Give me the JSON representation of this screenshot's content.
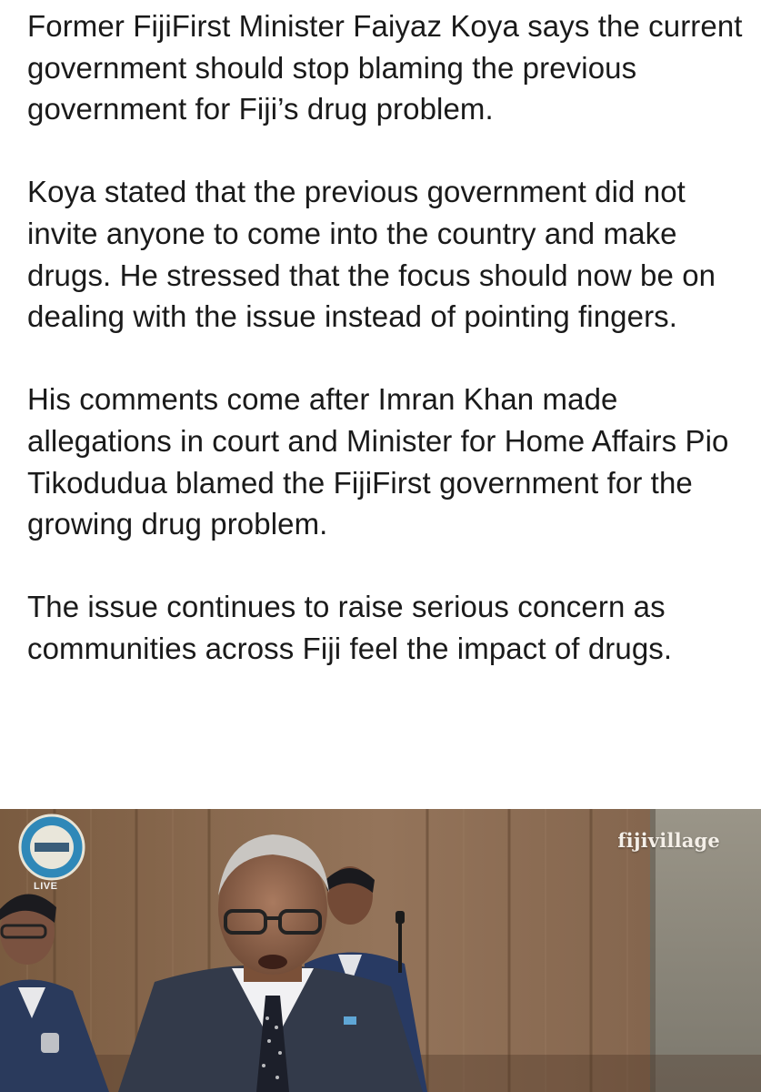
{
  "article": {
    "paragraphs": [
      "Former FijiFirst Minister Faiyaz Koya says the current government should stop blaming the previous government for Fiji’s drug problem.",
      "Koya stated that the previous government did not invite anyone to come into the country and make drugs. He stressed that the focus should now be on dealing with the issue instead of pointing fingers.",
      "His comments come after Imran Khan made allegations in court and Minister for Home Affairs Pio Tikodudua blamed the FijiFirst government for the growing drug problem.",
      "The issue continues to raise serious concern as communities across Fiji feel the impact of drugs."
    ]
  },
  "photo": {
    "watermark": "fijivillage",
    "live_label": "LIVE"
  },
  "colors": {
    "text": "#1a1a1a",
    "background": "#ffffff",
    "wood_panel": "#8a6b4e"
  }
}
